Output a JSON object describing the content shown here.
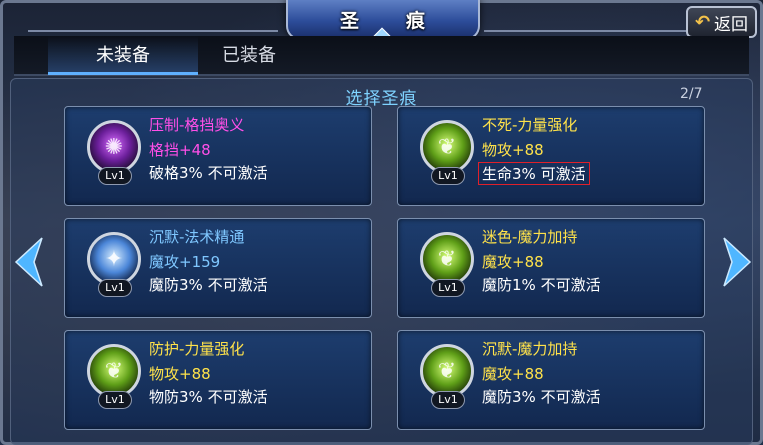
{
  "window": {
    "title_left": "圣",
    "title_right": "痕",
    "back_label": "返回"
  },
  "tabs": [
    {
      "label": "未装备",
      "active": true
    },
    {
      "label": "已装备",
      "active": false
    }
  ],
  "panel": {
    "title": "选择圣痕",
    "page": "2/7"
  },
  "cards": [
    {
      "name": "压制-格挡奥义",
      "name_color": "#ff4fe8",
      "stat": "格挡+48",
      "stat_color": "#ff4fe8",
      "skill": "破格3% 不可激活",
      "level": "Lv1",
      "orb": "purple",
      "icon": "parry-emblem-icon",
      "boxed": false
    },
    {
      "name": "不死-力量强化",
      "name_color": "#ffe24a",
      "stat": "物攻+88",
      "stat_color": "#ffe24a",
      "skill": "生命3% 可激活",
      "level": "Lv1",
      "orb": "green",
      "icon": "strength-emblem-icon",
      "boxed": true
    },
    {
      "name": "沉默-法术精通",
      "name_color": "#7fc7ff",
      "stat": "魔攻+159",
      "stat_color": "#7fc7ff",
      "skill": "魔防3% 不可激活",
      "level": "Lv1",
      "orb": "blue",
      "icon": "spell-emblem-icon",
      "boxed": false
    },
    {
      "name": "迷色-魔力加持",
      "name_color": "#ffe24a",
      "stat": "魔攻+88",
      "stat_color": "#ffe24a",
      "skill": "魔防1% 不可激活",
      "level": "Lv1",
      "orb": "green",
      "icon": "mana-emblem-icon",
      "boxed": false
    },
    {
      "name": "防护-力量强化",
      "name_color": "#ffe24a",
      "stat": "物攻+88",
      "stat_color": "#ffe24a",
      "skill": "物防3% 不可激活",
      "level": "Lv1",
      "orb": "green",
      "icon": "strength-emblem-icon",
      "boxed": false
    },
    {
      "name": "沉默-魔力加持",
      "name_color": "#ffe24a",
      "stat": "魔攻+88",
      "stat_color": "#ffe24a",
      "skill": "魔防3% 不可激活",
      "level": "Lv1",
      "orb": "green",
      "icon": "mana-emblem-icon",
      "boxed": false
    }
  ],
  "nav": {
    "prev_icon": "chevron-left-icon",
    "next_icon": "chevron-right-icon",
    "arrow_color": "#4fb6ff"
  }
}
